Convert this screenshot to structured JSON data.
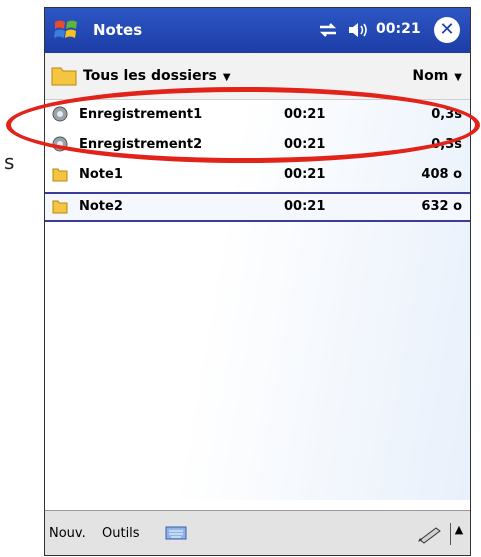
{
  "stray_text": "s",
  "titlebar": {
    "title": "Notes",
    "time": "00:21",
    "close_label": "✕"
  },
  "folderbar": {
    "folder_label": "Tous les dossiers",
    "sort_label": "Nom"
  },
  "files": [
    {
      "name": "Enregistrement1",
      "time": "00:21",
      "size": "0,3s",
      "icon": "recording-icon"
    },
    {
      "name": "Enregistrement2",
      "time": "00:21",
      "size": "0,3s",
      "icon": "recording-icon"
    },
    {
      "name": "Note1",
      "time": "00:21",
      "size": "408 o",
      "icon": "note-icon"
    },
    {
      "name": "Note2",
      "time": "00:21",
      "size": "632 o",
      "icon": "note-icon",
      "selected": true
    }
  ],
  "menubar": {
    "new_label": "Nouv.",
    "tools_label": "Outils"
  },
  "colors": {
    "titlebar": "#1c3da6",
    "highlight_oval": "#e2231a",
    "selection_border": "#3b3b9c"
  }
}
